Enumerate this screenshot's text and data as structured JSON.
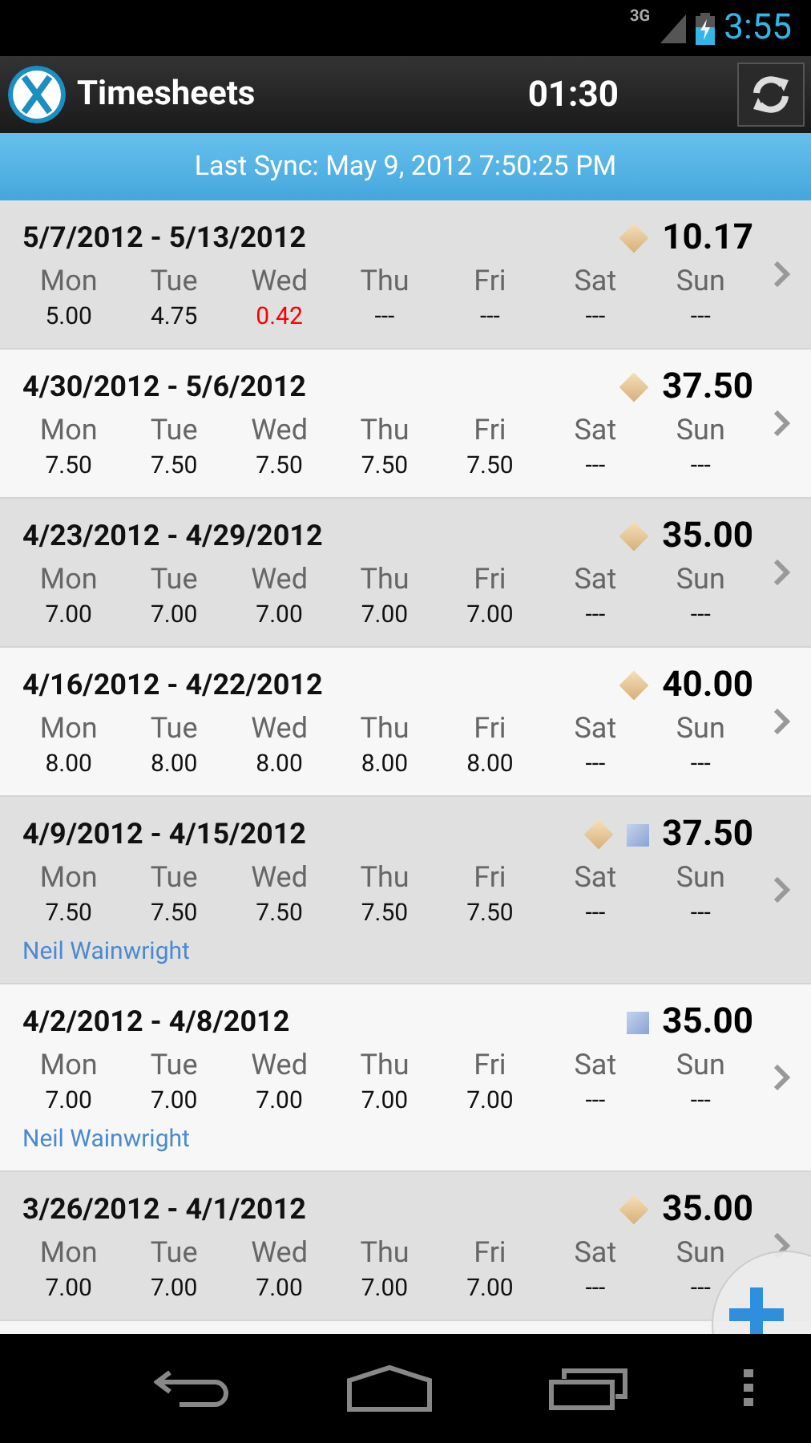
{
  "status_bar": {
    "network": "3G",
    "time": "3:55"
  },
  "app_bar": {
    "title": "Timesheets",
    "timer": "01:30"
  },
  "sync_banner": {
    "text": "Last Sync: May 9, 2012 7:50:25 PM"
  },
  "weeks": [
    {
      "range": "5/7/2012 - 5/13/2012",
      "diamond": true,
      "square": false,
      "total": "10.17",
      "days": [
        {
          "day": "Mon",
          "hours": "5.00",
          "active": false
        },
        {
          "day": "Tue",
          "hours": "4.75",
          "active": false
        },
        {
          "day": "Wed",
          "hours": "0.42",
          "active": true
        },
        {
          "day": "Thu",
          "hours": "---",
          "active": false
        },
        {
          "day": "Fri",
          "hours": "---",
          "active": false
        },
        {
          "day": "Sat",
          "hours": "---",
          "active": false
        },
        {
          "day": "Sun",
          "hours": "---",
          "active": false
        }
      ]
    },
    {
      "range": "4/30/2012 - 5/6/2012",
      "diamond": true,
      "square": false,
      "total": "37.50",
      "days": [
        {
          "day": "Mon",
          "hours": "7.50",
          "active": false
        },
        {
          "day": "Tue",
          "hours": "7.50",
          "active": false
        },
        {
          "day": "Wed",
          "hours": "7.50",
          "active": false
        },
        {
          "day": "Thu",
          "hours": "7.50",
          "active": false
        },
        {
          "day": "Fri",
          "hours": "7.50",
          "active": false
        },
        {
          "day": "Sat",
          "hours": "---",
          "active": false
        },
        {
          "day": "Sun",
          "hours": "---",
          "active": false
        }
      ]
    },
    {
      "range": "4/23/2012 - 4/29/2012",
      "diamond": true,
      "square": false,
      "total": "35.00",
      "days": [
        {
          "day": "Mon",
          "hours": "7.00",
          "active": false
        },
        {
          "day": "Tue",
          "hours": "7.00",
          "active": false
        },
        {
          "day": "Wed",
          "hours": "7.00",
          "active": false
        },
        {
          "day": "Thu",
          "hours": "7.00",
          "active": false
        },
        {
          "day": "Fri",
          "hours": "7.00",
          "active": false
        },
        {
          "day": "Sat",
          "hours": "---",
          "active": false
        },
        {
          "day": "Sun",
          "hours": "---",
          "active": false
        }
      ]
    },
    {
      "range": "4/16/2012 - 4/22/2012",
      "diamond": true,
      "square": false,
      "total": "40.00",
      "days": [
        {
          "day": "Mon",
          "hours": "8.00",
          "active": false
        },
        {
          "day": "Tue",
          "hours": "8.00",
          "active": false
        },
        {
          "day": "Wed",
          "hours": "8.00",
          "active": false
        },
        {
          "day": "Thu",
          "hours": "8.00",
          "active": false
        },
        {
          "day": "Fri",
          "hours": "8.00",
          "active": false
        },
        {
          "day": "Sat",
          "hours": "---",
          "active": false
        },
        {
          "day": "Sun",
          "hours": "---",
          "active": false
        }
      ]
    },
    {
      "range": "4/9/2012 - 4/15/2012",
      "diamond": true,
      "square": true,
      "total": "37.50",
      "days": [
        {
          "day": "Mon",
          "hours": "7.50",
          "active": false
        },
        {
          "day": "Tue",
          "hours": "7.50",
          "active": false
        },
        {
          "day": "Wed",
          "hours": "7.50",
          "active": false
        },
        {
          "day": "Thu",
          "hours": "7.50",
          "active": false
        },
        {
          "day": "Fri",
          "hours": "7.50",
          "active": false
        },
        {
          "day": "Sat",
          "hours": "---",
          "active": false
        },
        {
          "day": "Sun",
          "hours": "---",
          "active": false
        }
      ],
      "person": "Neil Wainwright"
    },
    {
      "range": "4/2/2012 - 4/8/2012",
      "diamond": false,
      "square": true,
      "total": "35.00",
      "days": [
        {
          "day": "Mon",
          "hours": "7.00",
          "active": false
        },
        {
          "day": "Tue",
          "hours": "7.00",
          "active": false
        },
        {
          "day": "Wed",
          "hours": "7.00",
          "active": false
        },
        {
          "day": "Thu",
          "hours": "7.00",
          "active": false
        },
        {
          "day": "Fri",
          "hours": "7.00",
          "active": false
        },
        {
          "day": "Sat",
          "hours": "---",
          "active": false
        },
        {
          "day": "Sun",
          "hours": "---",
          "active": false
        }
      ],
      "person": "Neil Wainwright"
    },
    {
      "range": "3/26/2012 - 4/1/2012",
      "diamond": true,
      "square": false,
      "total": "35.00",
      "days": [
        {
          "day": "Mon",
          "hours": "7.00",
          "active": false
        },
        {
          "day": "Tue",
          "hours": "7.00",
          "active": false
        },
        {
          "day": "Wed",
          "hours": "7.00",
          "active": false
        },
        {
          "day": "Thu",
          "hours": "7.00",
          "active": false
        },
        {
          "day": "Fri",
          "hours": "7.00",
          "active": false
        },
        {
          "day": "Sat",
          "hours": "---",
          "active": false
        },
        {
          "day": "Sun",
          "hours": "---",
          "active": false
        }
      ]
    }
  ]
}
